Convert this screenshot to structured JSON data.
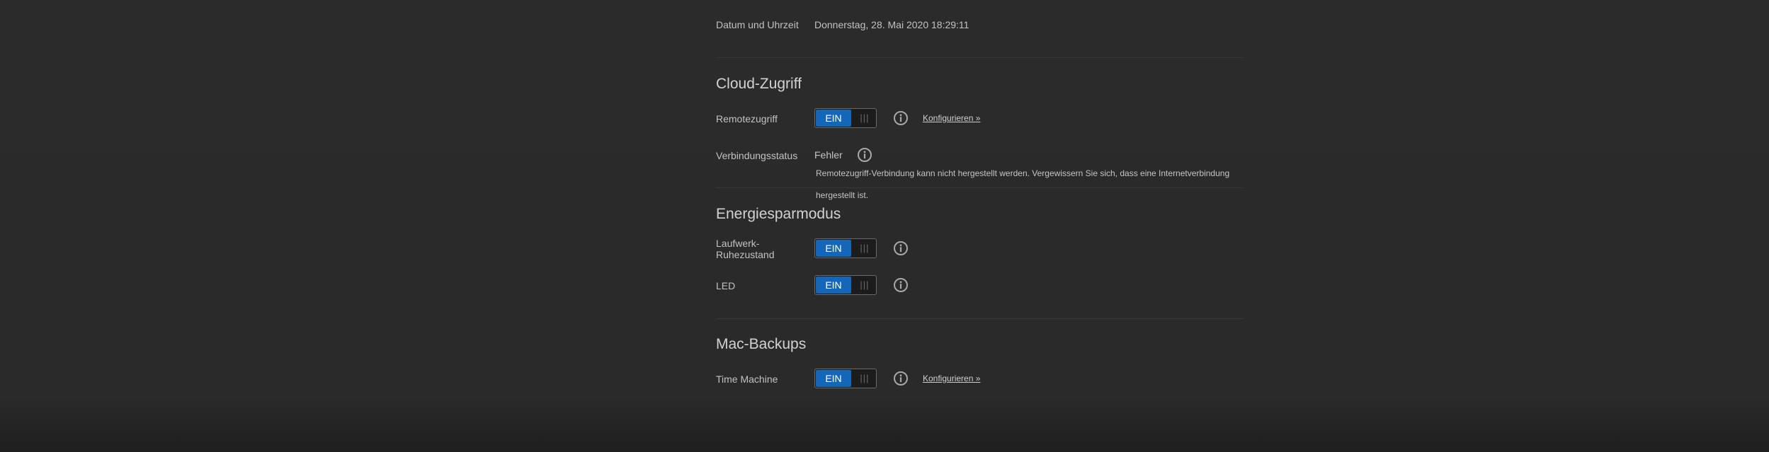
{
  "datetime": {
    "label": "Datum und Uhrzeit",
    "value": "Donnerstag, 28. Mai 2020 18:29:11"
  },
  "cloud": {
    "title": "Cloud-Zugriff",
    "remote": {
      "label": "Remotezugriff",
      "toggle_on": "EIN",
      "toggle_grip": "|||",
      "info_icon": "info-circle-icon",
      "link": "Konfigurieren »"
    },
    "status": {
      "label": "Verbindungsstatus",
      "value": "Fehler",
      "info_icon": "info-circle-icon",
      "message": "Remotezugriff-Verbindung kann nicht hergestellt werden. Vergewissern Sie sich, dass eine Internetverbindung hergestellt ist."
    }
  },
  "energy": {
    "title": "Energiesparmodus",
    "drive": {
      "label_line1": "Laufwerk-",
      "label_line2": "Ruhezustand",
      "toggle_on": "EIN",
      "toggle_grip": "|||",
      "info_icon": "info-circle-icon"
    },
    "led": {
      "label": "LED",
      "toggle_on": "EIN",
      "toggle_grip": "|||",
      "info_icon": "info-circle-icon"
    }
  },
  "mac": {
    "title": "Mac-Backups",
    "timemachine": {
      "label": "Time Machine",
      "toggle_on": "EIN",
      "toggle_grip": "|||",
      "info_icon": "info-circle-icon",
      "link": "Konfigurieren »"
    }
  },
  "colors": {
    "background": "#2a2a2a",
    "toggle_on": "#1467b8",
    "divider": "#383838"
  }
}
